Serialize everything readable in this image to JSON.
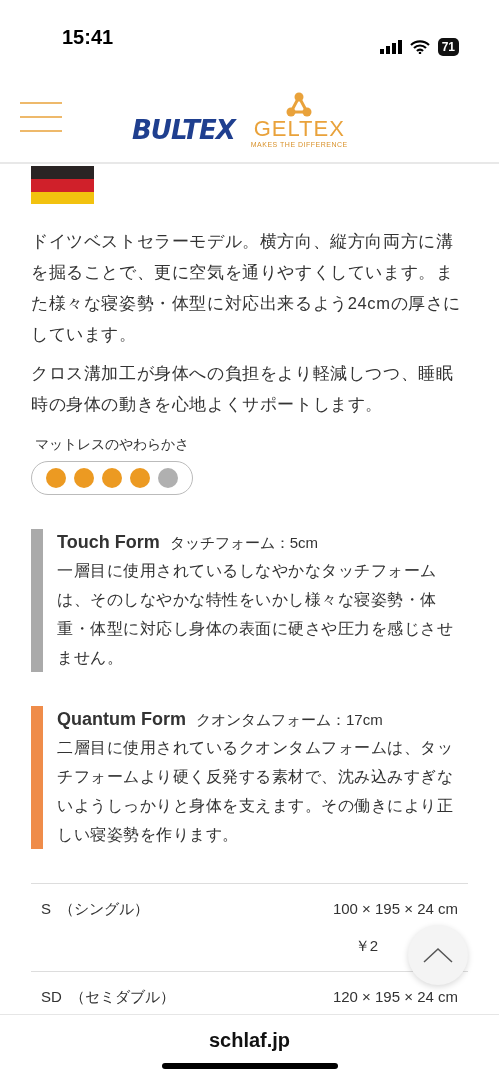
{
  "status_bar": {
    "time": "15:41",
    "battery": "71"
  },
  "header": {
    "logo_left": "BULTEX",
    "logo_right": "GELTEX",
    "logo_right_tagline": "MAKES THE DIFFERENCE"
  },
  "paragraphs": [
    "ドイツベストセラーモデル。横方向、縦方向両方に溝を掘ることで、更に空気を通りやすくしています。また様々な寝姿勢・体型に対応出来るよう24cmの厚さにしています。",
    "クロス溝加工が身体への負担をより軽減しつつ、睡眠時の身体の動きを心地よくサポートします。"
  ],
  "firmness": {
    "label": "マットレスのやわらかさ",
    "stars": 4
  },
  "layers": [
    {
      "name": "Touch Form",
      "subtitle": "タッチフォーム：5cm",
      "description": "一層目に使用されているしなやかなタッチフォームは、そのしなやかな特性をいかし様々な寝姿勢・体重・体型に対応し身体の表面に硬さや圧力を感じさせません。",
      "color": "#aaaaaa"
    },
    {
      "name": "Quantum Form",
      "subtitle": "クオンタムフォーム：17cm",
      "description": "二層目に使用されているクオンタムフォームは、タッチフォームより硬く反発する素材で、沈み込みすぎないようしっかりと身体を支えます。その働きにより正しい寝姿勢を作ります。",
      "color": "#ef8c4a"
    }
  ],
  "sizes": [
    {
      "code": "S",
      "name": "（シングル）",
      "dimensions": "100 × 195 × 24 cm",
      "price": "￥2"
    },
    {
      "code": "SD",
      "name": "（セミダブル）",
      "dimensions": "120 × 195 × 24 cm"
    }
  ],
  "browser_bar": {
    "url": "schlaf.jp"
  }
}
